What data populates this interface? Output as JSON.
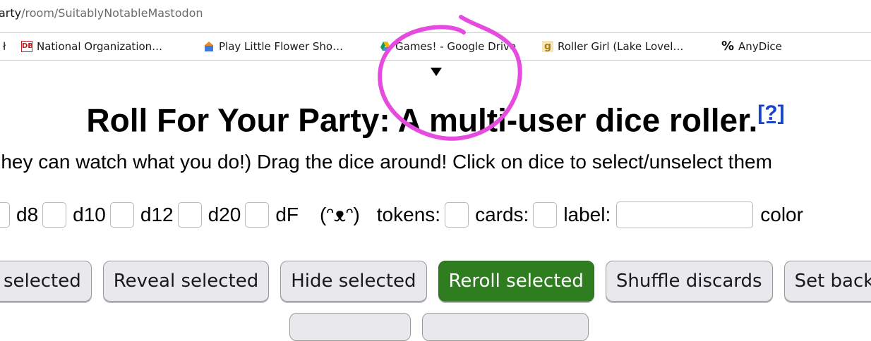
{
  "url": {
    "host": "arty",
    "path": "/room/SuitablyNotableMastodon"
  },
  "bookmarks": [
    {
      "label": "ł",
      "icon": "bookmark-icon"
    },
    {
      "label": "National Organization…",
      "icon": "db-logo-icon"
    },
    {
      "label": "Play Little Flower Sho…",
      "icon": "flower-shop-icon"
    },
    {
      "label": "Games! - Google Drive",
      "icon": "google-drive-icon"
    },
    {
      "label": "Roller Girl (Lake Lovel…",
      "icon": "goodreads-icon"
    },
    {
      "label": "AnyDice",
      "icon": "percent-icon"
    }
  ],
  "page": {
    "title": "Roll For Your Party: A multi-user dice roller.",
    "help_link": "[?]",
    "instructions": "'hey can watch what you do!) Drag the dice around! Click on dice to select/unselect them"
  },
  "controls": {
    "d8": "d8",
    "d10": "d10",
    "d12": "d12",
    "d20": "d20",
    "dF": "dF",
    "lenny": "(ᵔᴥᵔ)",
    "tokens": "tokens:",
    "cards": "cards:",
    "label": "label:",
    "color": "color"
  },
  "buttons": [
    {
      "label": "selected"
    },
    {
      "label": "Reveal selected"
    },
    {
      "label": "Hide selected"
    },
    {
      "label": "Reroll selected",
      "accent": "#2e7d1f"
    },
    {
      "label": "Shuffle discards"
    },
    {
      "label": "Set backg"
    }
  ],
  "colors": {
    "annotation": "#e64be0",
    "primary_button": "#2e7d1f",
    "link": "#1a44c8"
  }
}
